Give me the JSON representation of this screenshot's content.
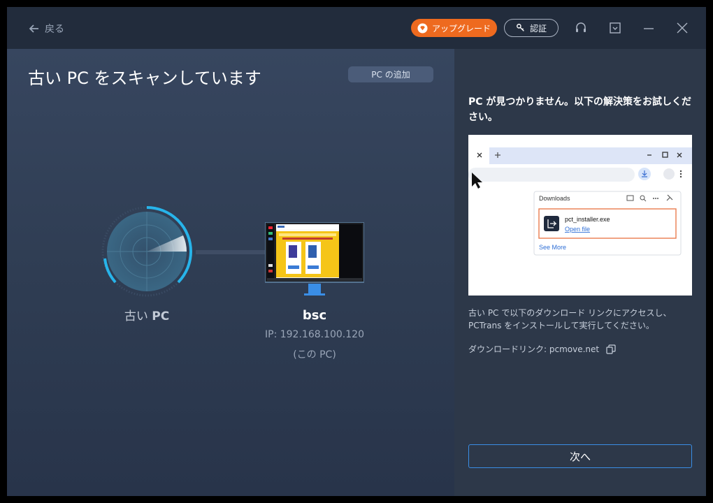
{
  "titlebar": {
    "back_label": "戻る",
    "upgrade_label": "アップグレード",
    "auth_label": "認証"
  },
  "main": {
    "title": "古い PC をスキャンしています",
    "add_pc_label": "PC の追加",
    "old_pc_label_prefix": "古い ",
    "old_pc_label_bold": "PC",
    "pc_name": "bsc",
    "pc_ip": "IP: 192.168.100.120",
    "pc_self": "(この PC)"
  },
  "right": {
    "notfound_bold": "PC",
    "notfound_text": " が見つかりません。以下の解決策をお試しください。",
    "illustration": {
      "downloads_title": "Downloads",
      "file_name": "pct_installer.exe",
      "open_file": "Open file",
      "see_more": "See More"
    },
    "instructions": "古い PC で以下のダウンロード リンクにアクセスし、PCTrans をインストールして実行してください。",
    "download_link_label": "ダウンロードリンク: pcmove.net",
    "next_label": "次へ"
  },
  "colors": {
    "accent": "#ee6a1f",
    "button_border": "#3a8ee6",
    "radar_ring": "#27b4ea"
  }
}
